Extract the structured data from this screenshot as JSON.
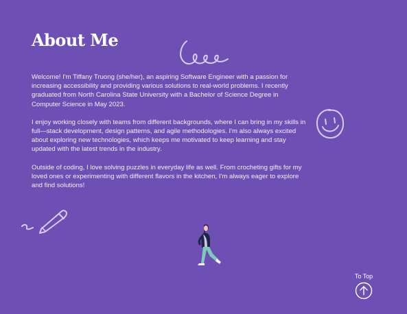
{
  "about": {
    "title": "About Me",
    "paragraphs": [
      "Welcome!  I'm Tiffany Truong (she/her), an aspiring Software Engineer with a passion for increasing accessibility and providing various solutions to real-world problems. I recently graduated from North Carolina State University with a Bachelor of Science Degree in Computer Science in May 2023.",
      "I enjoy working closely with teams from different backgrounds, where I can bring in my skills in full—stack development, design patterns, and agile methodologies. I'm also always excited about exploring new technologies, which keeps me motivated to keep learning and stay updated with the latest trends in the industry.",
      "Outside of coding, I love solving puzzles in everyday life as well. From crocheting gifts for my loved ones or experimenting with different flavors in the kitchen, I'm always eager to explore and find solutions!"
    ]
  },
  "to_top": {
    "label": "To Top",
    "icon": "arrow-up-circle-icon"
  },
  "decorations": {
    "loops": "loop-scribble-icon",
    "smiley": "smiley-face-icon",
    "pencil": "pencil-scribble-icon",
    "figure": "walking-person-illustration"
  },
  "colors": {
    "background": "#6e4fb4",
    "doodle_stroke": "#d9cdf5",
    "text": "#ffffff"
  }
}
